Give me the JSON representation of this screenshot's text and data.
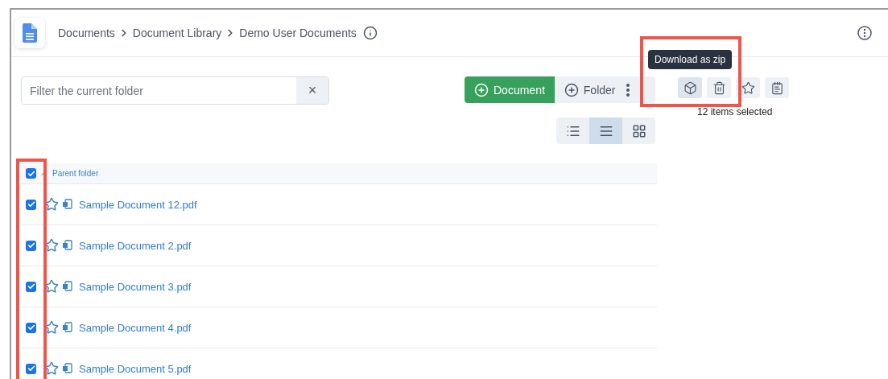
{
  "breadcrumb": {
    "items": [
      "Documents",
      "Document Library",
      "Demo User Documents"
    ]
  },
  "filter": {
    "placeholder": "Filter the current folder",
    "clear": "×"
  },
  "add_buttons": [
    {
      "label": "Document",
      "kind": "primary"
    },
    {
      "label": "Folder",
      "kind": "secondary"
    }
  ],
  "actions": [
    {
      "kind": "zip",
      "selected": true
    },
    {
      "kind": "trash",
      "selected": false
    },
    {
      "kind": "star",
      "selected": false
    },
    {
      "kind": "note",
      "selected": false
    }
  ],
  "tooltip": "Download as zip",
  "selection_count": "12 items selected",
  "view_modes": [
    {
      "kind": "list",
      "selected": false
    },
    {
      "kind": "compact",
      "selected": true
    },
    {
      "kind": "grid",
      "selected": false
    }
  ],
  "table": {
    "all_checked": true,
    "parent_label": "Parent folder",
    "rows": [
      {
        "name": "Sample Document 12.pdf",
        "checked": true,
        "starred": false
      },
      {
        "name": "Sample Document 2.pdf",
        "checked": true,
        "starred": false
      },
      {
        "name": "Sample Document 3.pdf",
        "checked": true,
        "starred": false
      },
      {
        "name": "Sample Document 4.pdf",
        "checked": true,
        "starred": false
      },
      {
        "name": "Sample Document 5.pdf",
        "checked": true,
        "starred": false
      }
    ]
  }
}
